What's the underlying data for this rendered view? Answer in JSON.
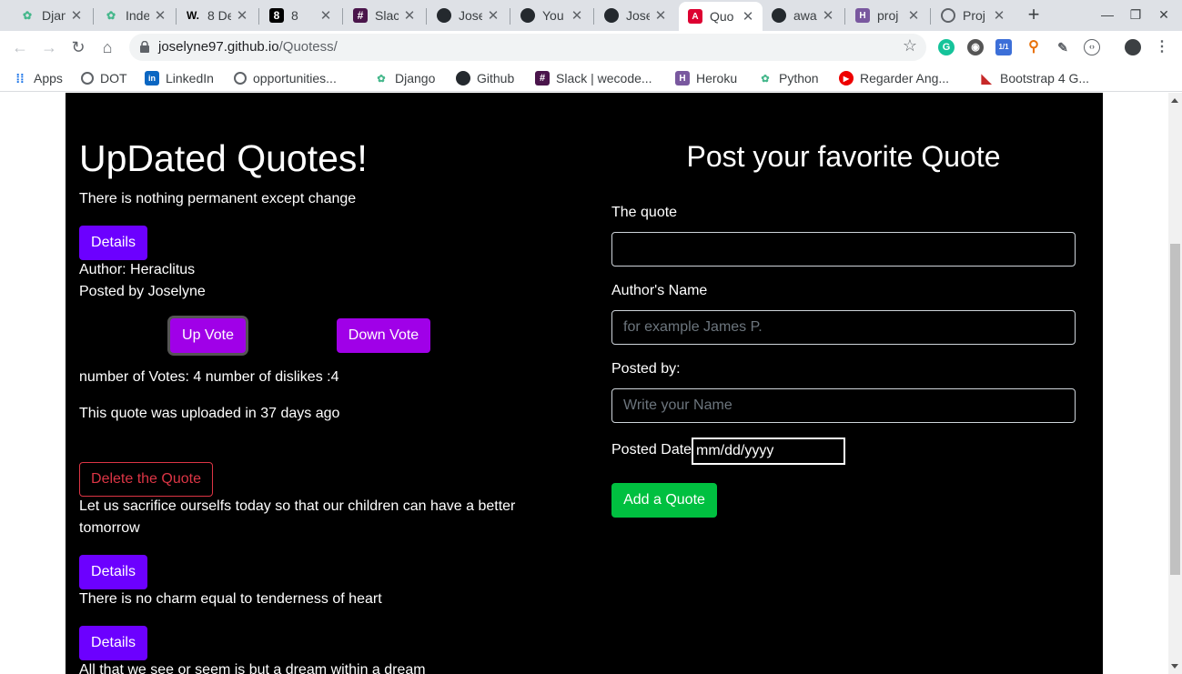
{
  "browser": {
    "tabs": [
      {
        "title": "Djan",
        "icon": "django-icon",
        "color": "#44b78b"
      },
      {
        "title": "Inde",
        "icon": "django-icon",
        "color": "#44b78b"
      },
      {
        "title": "8 De",
        "icon": "w-icon",
        "favicon_text": "W.",
        "color": "#000000"
      },
      {
        "title": "8",
        "icon": "eight-icon",
        "favicon_text": "8",
        "color": "#000000"
      },
      {
        "title": "Slac",
        "icon": "slack-icon",
        "color": "#4a154b"
      },
      {
        "title": "Jose",
        "icon": "github-icon",
        "color": "#24292e"
      },
      {
        "title": "You",
        "icon": "github-icon",
        "color": "#24292e"
      },
      {
        "title": "Jose",
        "icon": "github-icon",
        "color": "#24292e"
      },
      {
        "title": "Quo",
        "icon": "angular-icon",
        "color": "#dd0031",
        "active": true
      },
      {
        "title": "awa",
        "icon": "github-icon",
        "color": "#24292e"
      },
      {
        "title": "proj",
        "icon": "heroku-icon",
        "favicon_text": "H",
        "color": "#79589f"
      },
      {
        "title": "Proj",
        "icon": "globe-icon",
        "color": "#5f6368"
      }
    ],
    "url": {
      "domain": "joselyne97.github.io",
      "path": "/Quotess/"
    },
    "extension_badge": "1/1",
    "bookmarks": [
      {
        "label": "Apps",
        "icon": "apps-grid-icon"
      },
      {
        "label": "DOT",
        "icon": "globe-icon"
      },
      {
        "label": "LinkedIn",
        "icon": "linkedin-icon"
      },
      {
        "label": "opportunities...",
        "icon": "globe-icon"
      },
      {
        "label": "Django",
        "icon": "django-icon"
      },
      {
        "label": "Github",
        "icon": "github-icon"
      },
      {
        "label": "Slack | wecode...",
        "icon": "slack-icon"
      },
      {
        "label": "Heroku",
        "icon": "heroku-icon"
      },
      {
        "label": "Python",
        "icon": "django-icon"
      },
      {
        "label": "Regarder Ang...",
        "icon": "play-icon"
      },
      {
        "label": "Bootstrap 4 G...",
        "icon": "bootstrap-icon"
      }
    ]
  },
  "quotes": {
    "heading": "UpDated Quotes!",
    "items": [
      {
        "text": "There is nothing permanent except change",
        "details_label": "Details"
      },
      {
        "text": "Let us sacrifice ourselfs today so that our children can have a better tomorrow",
        "details_label": "Details"
      },
      {
        "text": "There is no charm equal to tenderness of heart",
        "details_label": "Details"
      },
      {
        "text": "All that we see or seem is but a dream within a dream"
      }
    ],
    "expanded": {
      "author": "Author: Heraclitus",
      "posted_by": "Posted by Joselyne",
      "upvote_label": "Up Vote",
      "downvote_label": "Down Vote",
      "votes": "number of Votes: 4 number of dislikes :4",
      "uploaded": "This quote was uploaded in 37 days ago",
      "delete_label": "Delete the Quote"
    }
  },
  "form": {
    "heading": "Post your favorite Quote",
    "quote_label": "The quote",
    "quote_value": "",
    "author_label": "Author's Name",
    "author_placeholder": "for example James P.",
    "posted_by_label": "Posted by:",
    "posted_by_placeholder": "Write your Name",
    "date_label": "Posted Date",
    "date_value": "mm/dd/yyyy",
    "submit_label": "Add a Quote"
  },
  "colors": {
    "page_bg": "#000000",
    "details_button": "#6c00ff",
    "vote_button": "#a000e8",
    "delete_button": "#dc3545",
    "add_button": "#00c040"
  }
}
